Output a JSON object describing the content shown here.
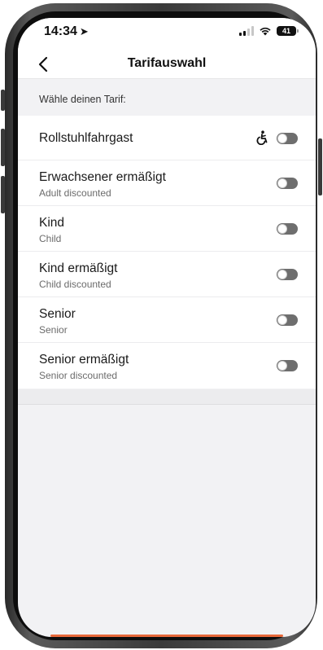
{
  "status_bar": {
    "time": "14:34",
    "location_icon": "location-arrow-icon",
    "battery_level": "41"
  },
  "nav": {
    "title": "Tarifauswahl",
    "back_icon": "chevron-left-icon"
  },
  "section": {
    "heading": "Wähle deinen Tarif:"
  },
  "tariffs": [
    {
      "label": "Rollstuhlfahrgast",
      "sub": "",
      "icon": "wheelchair-icon",
      "enabled": false
    },
    {
      "label": "Erwachsener ermäßigt",
      "sub": "Adult discounted",
      "enabled": false
    },
    {
      "label": "Kind",
      "sub": "Child",
      "enabled": false
    },
    {
      "label": "Kind ermäßigt",
      "sub": "Child discounted",
      "enabled": false
    },
    {
      "label": "Senior",
      "sub": "Senior",
      "enabled": false
    },
    {
      "label": "Senior ermäßigt",
      "sub": "Senior discounted",
      "enabled": false
    }
  ],
  "colors": {
    "toggle_off": "#6e6e6e",
    "background": "#f2f2f4",
    "accent_bottom": "#e8693a"
  }
}
